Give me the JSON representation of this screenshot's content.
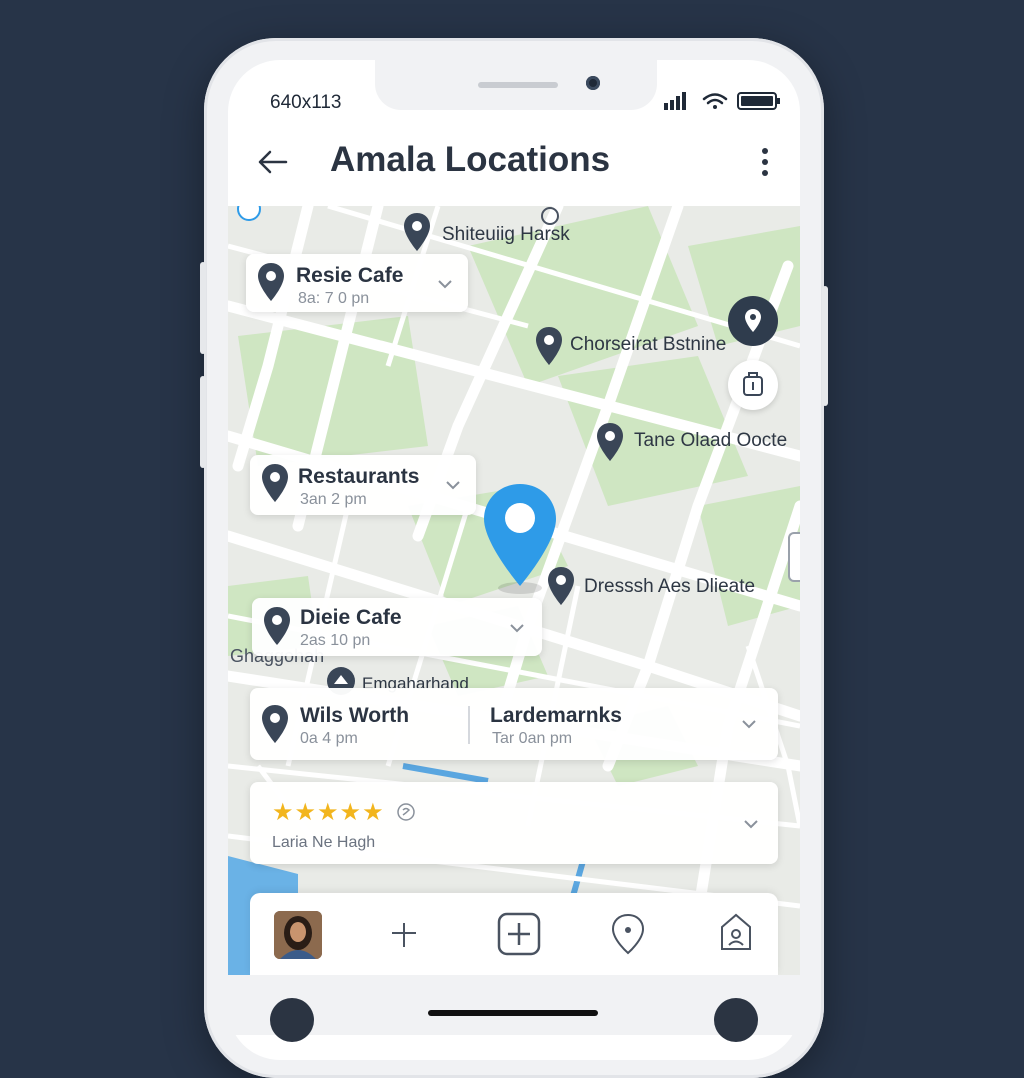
{
  "status_bar": {
    "time": "640x113"
  },
  "header": {
    "title": "Amala Locations"
  },
  "map": {
    "labels": [
      {
        "name": "shiteuig",
        "text": "Shiteuiig Harsk"
      },
      {
        "name": "chorseirat",
        "text": "Chorseirat Bstnine"
      },
      {
        "name": "tane-olaad",
        "text": "Tane Olaad Oocte"
      },
      {
        "name": "dresssh",
        "text": "Dresssh Aes Dlieate"
      },
      {
        "name": "ghaggohah",
        "text": "Ghaggohah"
      },
      {
        "name": "emgaharhand",
        "text": "Emgaharhand"
      }
    ]
  },
  "cards": {
    "resie": {
      "title": "Resie Cafe",
      "sub": "8a: 7 0 pn"
    },
    "restaurants": {
      "title": "Restaurants",
      "sub": "3an 2 pm"
    },
    "dieie": {
      "title": "Dieie Cafe",
      "sub": "2as 10 pn"
    },
    "wils": {
      "title": "Wils Worth",
      "sub": "0a 4 pm",
      "title2": "Lardemarnks",
      "sub2": "Tar 0an pm"
    },
    "review": {
      "rating": 5,
      "stars": "★★★★★",
      "info": "Laria Ne Hagh"
    }
  },
  "colors": {
    "accent": "#2e9be8",
    "pin": "#3a4657",
    "star": "#f2b51d",
    "park": "#cfe6c2",
    "road": "#ffffff",
    "water": "#6ab2e6"
  },
  "bottom_nav": {
    "items": [
      {
        "icon": "avatar"
      },
      {
        "icon": "plus-thin-icon"
      },
      {
        "icon": "add-square-icon"
      },
      {
        "icon": "pin-outline-icon"
      },
      {
        "icon": "profile-tag-icon"
      }
    ]
  }
}
